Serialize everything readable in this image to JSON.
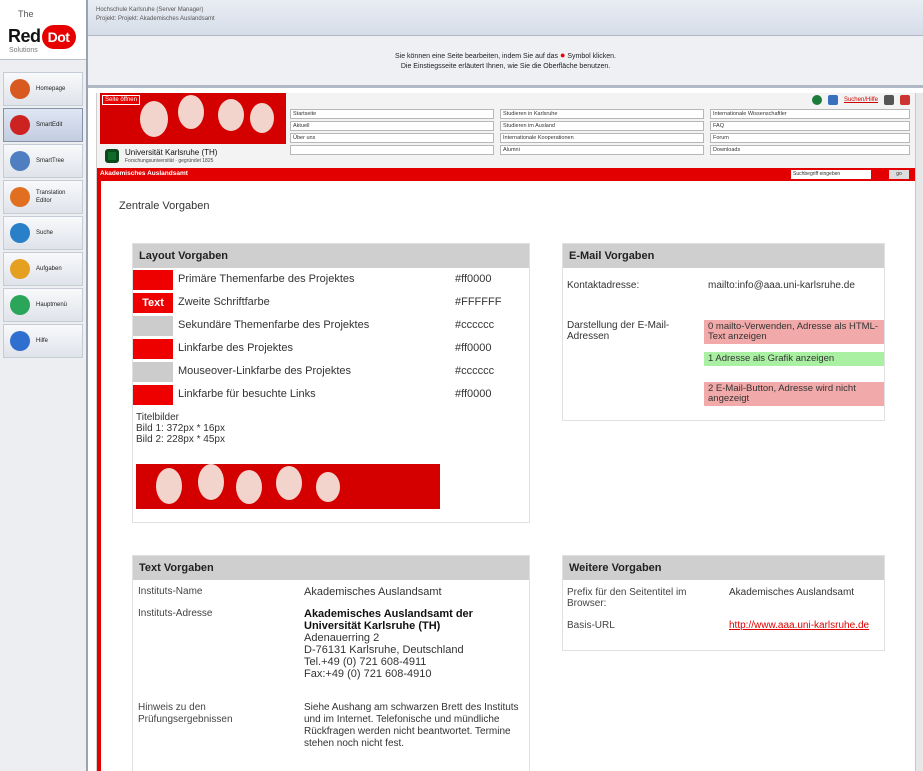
{
  "app": {
    "crumb_line1": "Hochschule Karlsruhe (Server Manager)",
    "crumb_line2": "Projekt: Projekt: Akademisches Auslandsamt",
    "notice_line1_pre": "Sie können eine Seite bearbeiten, indem Sie auf das",
    "notice_line1_post": "Symbol klicken.",
    "notice_line2": "Die Einstiegsseite erläutert Ihnen, wie Sie die Oberfläche benutzen."
  },
  "logo": {
    "small": "The",
    "red": "Red",
    "dot": "Dot",
    "sub": "Solutions"
  },
  "sidebar": {
    "items": [
      {
        "label": "Homepage",
        "color": "#d95a20"
      },
      {
        "label": "SmartEdit",
        "color": "#cc2222"
      },
      {
        "label": "SmartTree",
        "color": "#4f7fc1"
      },
      {
        "label": "Translation Editor",
        "color": "#e07020"
      },
      {
        "label": "Suche",
        "color": "#2a7fc9"
      },
      {
        "label": "Aufgaben",
        "color": "#e6a020"
      },
      {
        "label": "Hauptmenü",
        "color": "#2aa55a"
      },
      {
        "label": "Hilfe",
        "color": "#2f6fd0"
      }
    ]
  },
  "site": {
    "banner_tag": "Seite öffnen",
    "uni_name": "Universität Karlsruhe (TH)",
    "uni_sub": "Forschungsuniversität · gegründet 1825",
    "toolbar_link": "Suchen/Hilfe",
    "nav": [
      "Startseite",
      "Studieren in Karlsruhe",
      "Internationale Wissenschaftler",
      "Aktuell",
      "Studieren im Ausland",
      "FAQ",
      "Über uns",
      "Internationale Kooperationen",
      "Forum",
      "",
      "Alumni",
      "Downloads"
    ],
    "redbar_title": "Akademisches Auslandsamt",
    "search_placeholder": "Suchbegriff eingeben",
    "search_go": "go",
    "content_title": "Zentrale Vorgaben"
  },
  "layout_box": {
    "title": "Layout Vorgaben",
    "rows": [
      {
        "label": "Primäre Themenfarbe des Projektes",
        "value": "#ff0000",
        "swatch": "#ee0000",
        "swatch_text": ""
      },
      {
        "label": "Zweite Schriftfarbe",
        "value": "#FFFFFF",
        "swatch": "#ee0000",
        "swatch_text": "Text"
      },
      {
        "label": "Sekundäre Themenfarbe des Projektes",
        "value": "#cccccc",
        "swatch": "#cccccc",
        "swatch_text": ""
      },
      {
        "label": "Linkfarbe des Projektes",
        "value": "#ff0000",
        "swatch": "#ee0000",
        "swatch_text": ""
      },
      {
        "label": "Mouseover-Linkfarbe des Projektes",
        "value": "#cccccc",
        "swatch": "#cccccc",
        "swatch_text": ""
      },
      {
        "label": "Linkfarbe für besuchte Links",
        "value": "#ff0000",
        "swatch": "#ee0000",
        "swatch_text": ""
      }
    ],
    "titlepics_heading": "Titelbilder",
    "pic1": "Bild 1: 372px * 16px",
    "pic2": "Bild 2: 228px * 45px"
  },
  "email_box": {
    "title": "E-Mail Vorgaben",
    "contact_key": "Kontaktadresse:",
    "contact_value": "mailto:info@aaa.uni-karlsruhe.de",
    "display_key": "Darstellung der E-Mail-Adressen",
    "options": [
      {
        "text": "0 mailto-Verwenden, Adresse als HTML-Text anzeigen",
        "bg": "#f2a9a9"
      },
      {
        "text": "1 Adresse als Grafik anzeigen",
        "bg": "#a9f0a3"
      },
      {
        "text": "2 E-Mail-Button, Adresse wird nicht angezeigt",
        "bg": "#f2a9a9"
      }
    ]
  },
  "text_box": {
    "title": "Text Vorgaben",
    "name_key": "Instituts-Name",
    "name_value": "Akademisches Auslandsamt",
    "addr_key": "Instituts-Adresse",
    "addr_bold": "Akademisches Auslandsamt der Universität Karlsruhe (TH)",
    "addr_lines": [
      "Adenauerring 2",
      "D-76131 Karlsruhe, Deutschland",
      "Tel.+49 (0) 721 608-4911",
      "Fax:+49 (0) 721 608-4910"
    ],
    "hint_key": "Hinweis zu den Prüfungsergebnissen",
    "hint_value": "Siehe Aushang am schwarzen Brett des Instituts und im Internet. Telefonische und mündliche Rückfragen werden nicht beantwortet. Termine stehen noch nicht fest."
  },
  "more_box": {
    "title": "Weitere Vorgaben",
    "prefix_key": "Prefix für den Seitentitel im Browser:",
    "prefix_value": "Akademisches Auslandsamt",
    "url_key": "Basis-URL",
    "url_value": "http://www.aaa.uni-karlsruhe.de"
  }
}
